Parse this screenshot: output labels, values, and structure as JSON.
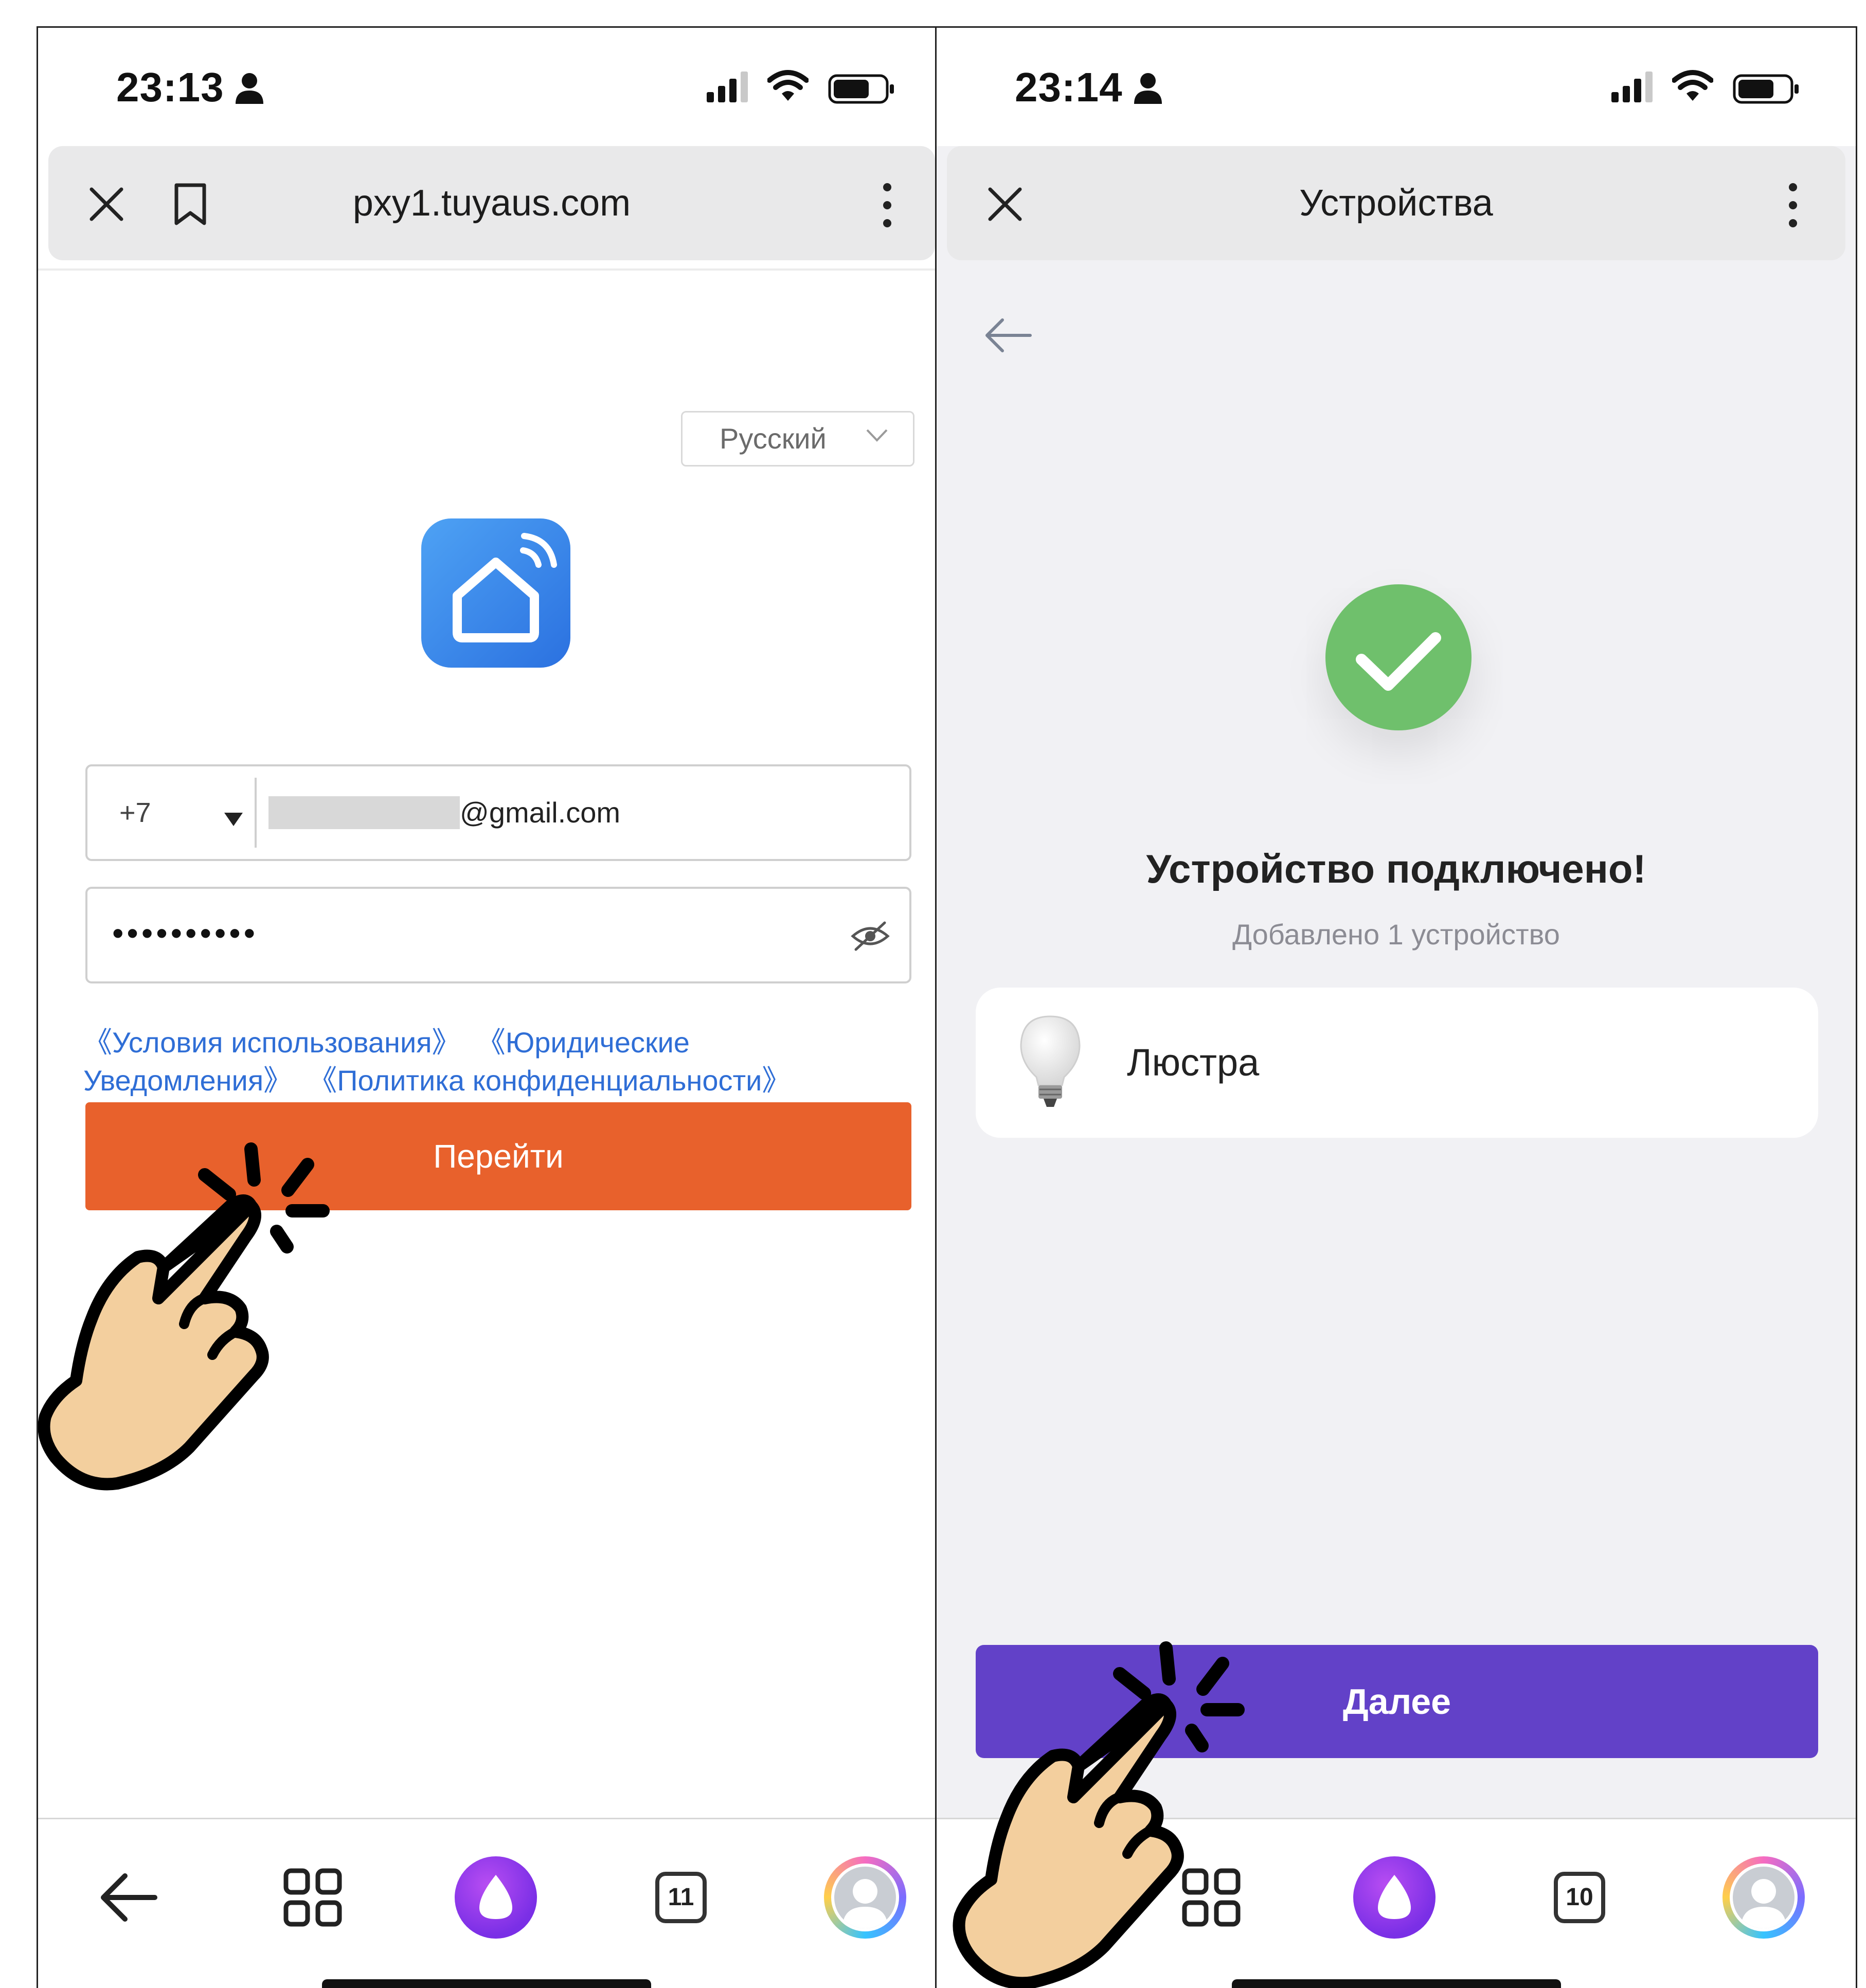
{
  "left": {
    "status": {
      "time": "23:13"
    },
    "browser": {
      "url": "pxy1.tuyaus.com"
    },
    "language": "Русский",
    "login": {
      "country_code": "+7",
      "email_suffix": "@gmail.com",
      "password_mask": "••••••••••"
    },
    "links": {
      "terms": "《Условия использования》",
      "legal": "《Юридические Уведомления》",
      "privacy": "《Политика конфиденциальности》"
    },
    "go_button": "Перейти",
    "nav": {
      "tabs_count": "11"
    }
  },
  "right": {
    "status": {
      "time": "23:14"
    },
    "header_title": "Устройства",
    "success_title": "Устройство подключено!",
    "success_subtitle": "Добавлено 1 устройство",
    "device": {
      "name": "Люстра",
      "icon": "light-bulb-icon"
    },
    "next_button": "Далее",
    "nav": {
      "tabs_count": "10"
    }
  },
  "colors": {
    "orange_button": "#e8612c",
    "purple_button": "#6241c8",
    "success_green": "#6fc06c",
    "link_blue": "#2f6ed6",
    "app_logo_blue": "#2b71e0"
  },
  "icons": [
    "close-icon",
    "bookmark-icon",
    "more-vertical-icon",
    "back-arrow-icon",
    "grid-icon",
    "alice-icon",
    "avatar-icon",
    "eye-off-icon",
    "chevron-down-icon",
    "checkmark-icon",
    "tap-hand-icon"
  ]
}
